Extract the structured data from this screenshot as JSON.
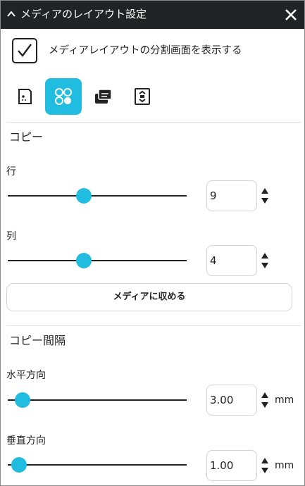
{
  "panel": {
    "title": "メディアのレイアウト設定"
  },
  "show_split": {
    "checked": true,
    "label": "メディアレイアウトの分割画面を表示する"
  },
  "tabs": [
    {
      "icon": "page-icon",
      "active": false
    },
    {
      "icon": "grid-dots-icon",
      "active": true
    },
    {
      "icon": "stacked-layers-icon",
      "active": false
    },
    {
      "icon": "fit-frame-icon",
      "active": false
    }
  ],
  "copy": {
    "title": "コピー",
    "rows": {
      "label": "行",
      "value": "9",
      "slider_fraction": 0.42
    },
    "columns": {
      "label": "列",
      "value": "4",
      "slider_fraction": 0.42
    },
    "fit_button": "メディアに収める"
  },
  "spacing": {
    "title": "コピー間隔",
    "horizontal": {
      "label": "水平方向",
      "value": "3.00",
      "unit": "mm",
      "slider_fraction": 0.05
    },
    "vertical": {
      "label": "垂直方向",
      "value": "1.00",
      "unit": "mm",
      "slider_fraction": 0.03
    }
  },
  "colors": {
    "accent": "#21bde0",
    "titlebar": "#222326"
  }
}
